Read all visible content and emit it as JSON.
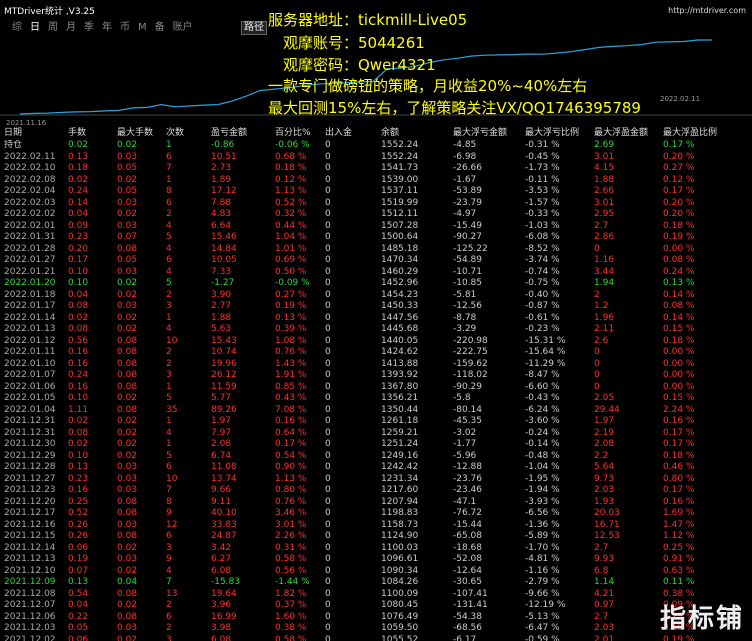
{
  "app": {
    "title": "MTDriver统计 ,V3.25",
    "site_url": "http://mtdriver.com"
  },
  "period_tabs": [
    "综",
    "日",
    "周",
    "月",
    "季",
    "年",
    "币",
    "M",
    "备",
    "账户"
  ],
  "active_tab": "日",
  "trace_button_label": "路径",
  "overlay": {
    "line1": "服务器地址：tickmill-Live05",
    "line2": "观摩账号：5044261",
    "line3": "观摩密码：Qwer4321",
    "line4": "一款专门做磅钮的策略，月收益20%~40%左右",
    "line5": "最大回测15%左右，了解策略关注VX/QQ1746395789"
  },
  "chart_data": {
    "type": "line",
    "x_start_label": "2021.11.16",
    "x_end_label": "2022.02.11",
    "color": "#29a3e0",
    "baseline_color": "#444444",
    "grid": false,
    "y_label_visible": false,
    "balance": [
      1034,
      1038,
      1040,
      1045,
      1049,
      1051,
      1055.52,
      1059.5,
      1076.49,
      1080.45,
      1100.09,
      1084.26,
      1090.34,
      1096.61,
      1100.03,
      1123.97,
      1158.73,
      1198.83,
      1207.94,
      1217.6,
      1231.34,
      1242.42,
      1249.16,
      1251.24,
      1259.21,
      1261.18,
      1350.44,
      1356.21,
      1367.8,
      1393.92,
      1413.88,
      1424.62,
      1440.05,
      1445.68,
      1447.56,
      1450.33,
      1454.23,
      1452.96,
      1460.29,
      1470.34,
      1485.18,
      1500.64,
      1507.28,
      1512.11,
      1519.99,
      1537.11,
      1539.0,
      1541.73,
      1552.24,
      1552.24
    ]
  },
  "watermark": "指标铺",
  "table": {
    "headers": [
      "日期",
      "手数",
      "最大手数",
      "次数",
      "盈亏金额",
      "百分比%",
      "出入金",
      "余额",
      "最大浮亏金额",
      "最大浮亏比例",
      "最大浮盈金额",
      "最大浮盈比例"
    ],
    "rows": [
      {
        "date": "持仓",
        "lots": "0.02",
        "max_lots": "0.02",
        "count": "1",
        "pl": "-0.86",
        "pct": "-0.06 %",
        "dep": "0",
        "bal": "1552.24",
        "mdd": "-4.85",
        "mdd_pct": "-0.31 %",
        "mfe": "2.69",
        "mfe_pct": "0.17 %",
        "pos": true
      },
      {
        "date": "2022.02.11",
        "lots": "0.13",
        "max_lots": "0.03",
        "count": "6",
        "pl": "10.51",
        "pct": "0.68 %",
        "dep": "0",
        "bal": "1552.24",
        "mdd": "-6.98",
        "mdd_pct": "-0.45 %",
        "mfe": "3.01",
        "mfe_pct": "0.20 %",
        "pos": false
      },
      {
        "date": "2022.02.10",
        "lots": "0.18",
        "max_lots": "0.05",
        "count": "7",
        "pl": "2.73",
        "pct": "0.18 %",
        "dep": "0",
        "bal": "1541.73",
        "mdd": "-26.66",
        "mdd_pct": "-1.73 %",
        "mfe": "4.15",
        "mfe_pct": "0.27 %",
        "pos": false
      },
      {
        "date": "2022.02.08",
        "lots": "0.02",
        "max_lots": "0.02",
        "count": "1",
        "pl": "1.89",
        "pct": "0.12 %",
        "dep": "0",
        "bal": "1539.00",
        "mdd": "-1.67",
        "mdd_pct": "-0.11 %",
        "mfe": "1.88",
        "mfe_pct": "0.12 %",
        "pos": false
      },
      {
        "date": "2022.02.04",
        "lots": "0.24",
        "max_lots": "0.05",
        "count": "8",
        "pl": "17.12",
        "pct": "1.13 %",
        "dep": "0",
        "bal": "1537.11",
        "mdd": "-53.89",
        "mdd_pct": "-3.53 %",
        "mfe": "2.66",
        "mfe_pct": "0.17 %",
        "pos": false
      },
      {
        "date": "2022.02.03",
        "lots": "0.14",
        "max_lots": "0.03",
        "count": "6",
        "pl": "7.88",
        "pct": "0.52 %",
        "dep": "0",
        "bal": "1519.99",
        "mdd": "-23.79",
        "mdd_pct": "-1.57 %",
        "mfe": "3.01",
        "mfe_pct": "0.20 %",
        "pos": false
      },
      {
        "date": "2022.02.02",
        "lots": "0.04",
        "max_lots": "0.02",
        "count": "2",
        "pl": "4.83",
        "pct": "0.32 %",
        "dep": "0",
        "bal": "1512.11",
        "mdd": "-4.97",
        "mdd_pct": "-0.33 %",
        "mfe": "2.95",
        "mfe_pct": "0.20 %",
        "pos": false
      },
      {
        "date": "2022.02.01",
        "lots": "0.09",
        "max_lots": "0.03",
        "count": "4",
        "pl": "6.64",
        "pct": "0.44 %",
        "dep": "0",
        "bal": "1507.28",
        "mdd": "-15.49",
        "mdd_pct": "-1.03 %",
        "mfe": "2.7",
        "mfe_pct": "0.18 %",
        "pos": false
      },
      {
        "date": "2022.01.31",
        "lots": "0.23",
        "max_lots": "0.07",
        "count": "5",
        "pl": "15.46",
        "pct": "1.04 %",
        "dep": "0",
        "bal": "1500.64",
        "mdd": "-90.27",
        "mdd_pct": "-6.08 %",
        "mfe": "2.86",
        "mfe_pct": "0.19 %",
        "pos": false
      },
      {
        "date": "2022.01.28",
        "lots": "0.20",
        "max_lots": "0.08",
        "count": "4",
        "pl": "14.84",
        "pct": "1.01 %",
        "dep": "0",
        "bal": "1485.18",
        "mdd": "-125.22",
        "mdd_pct": "-8.52 %",
        "mfe": "0",
        "mfe_pct": "0.00 %",
        "pos": false
      },
      {
        "date": "2022.01.27",
        "lots": "0.17",
        "max_lots": "0.05",
        "count": "6",
        "pl": "10.05",
        "pct": "0.69 %",
        "dep": "0",
        "bal": "1470.34",
        "mdd": "-54.89",
        "mdd_pct": "-3.74 %",
        "mfe": "1.16",
        "mfe_pct": "0.08 %",
        "pos": false
      },
      {
        "date": "2022.01.21",
        "lots": "0.10",
        "max_lots": "0.03",
        "count": "4",
        "pl": "7.33",
        "pct": "0.50 %",
        "dep": "0",
        "bal": "1460.29",
        "mdd": "-10.71",
        "mdd_pct": "-0.74 %",
        "mfe": "3.44",
        "mfe_pct": "0.24 %",
        "pos": false
      },
      {
        "date": "2022.01.20",
        "lots": "0.10",
        "max_lots": "0.02",
        "count": "5",
        "pl": "-1.27",
        "pct": "-0.09 %",
        "dep": "0",
        "bal": "1452.96",
        "mdd": "-10.85",
        "mdd_pct": "-0.75 %",
        "mfe": "1.94",
        "mfe_pct": "0.13 %",
        "pos": true
      },
      {
        "date": "2022.01.18",
        "lots": "0.04",
        "max_lots": "0.02",
        "count": "2",
        "pl": "3.90",
        "pct": "0.27 %",
        "dep": "0",
        "bal": "1454.23",
        "mdd": "-5.81",
        "mdd_pct": "-0.40 %",
        "mfe": "2",
        "mfe_pct": "0.14 %",
        "pos": false
      },
      {
        "date": "2022.01.17",
        "lots": "0.08",
        "max_lots": "0.03",
        "count": "3",
        "pl": "2.77",
        "pct": "0.19 %",
        "dep": "0",
        "bal": "1450.33",
        "mdd": "-12.56",
        "mdd_pct": "-0.87 %",
        "mfe": "1.2",
        "mfe_pct": "0.08 %",
        "pos": false
      },
      {
        "date": "2022.01.14",
        "lots": "0.02",
        "max_lots": "0.02",
        "count": "1",
        "pl": "1.88",
        "pct": "0.13 %",
        "dep": "0",
        "bal": "1447.56",
        "mdd": "-8.78",
        "mdd_pct": "-0.61 %",
        "mfe": "1.96",
        "mfe_pct": "0.14 %",
        "pos": false
      },
      {
        "date": "2022.01.13",
        "lots": "0.08",
        "max_lots": "0.02",
        "count": "4",
        "pl": "5.63",
        "pct": "0.39 %",
        "dep": "0",
        "bal": "1445.68",
        "mdd": "-3.29",
        "mdd_pct": "-0.23 %",
        "mfe": "2.11",
        "mfe_pct": "0.15 %",
        "pos": false
      },
      {
        "date": "2022.01.12",
        "lots": "0.56",
        "max_lots": "0.08",
        "count": "10",
        "pl": "15.43",
        "pct": "1.08 %",
        "dep": "0",
        "bal": "1440.05",
        "mdd": "-220.98",
        "mdd_pct": "-15.31 %",
        "mfe": "2.6",
        "mfe_pct": "0.18 %",
        "pos": false
      },
      {
        "date": "2022.01.11",
        "lots": "0.16",
        "max_lots": "0.08",
        "count": "2",
        "pl": "10.74",
        "pct": "0.76 %",
        "dep": "0",
        "bal": "1424.62",
        "mdd": "-222.75",
        "mdd_pct": "-15.64 %",
        "mfe": "0",
        "mfe_pct": "0.00 %",
        "pos": false
      },
      {
        "date": "2022.01.10",
        "lots": "0.16",
        "max_lots": "0.08",
        "count": "2",
        "pl": "19.96",
        "pct": "1.43 %",
        "dep": "0",
        "bal": "1413.88",
        "mdd": "-159.62",
        "mdd_pct": "-11.29 %",
        "mfe": "0",
        "mfe_pct": "0.00 %",
        "pos": false
      },
      {
        "date": "2022.01.07",
        "lots": "0.24",
        "max_lots": "0.08",
        "count": "3",
        "pl": "26.12",
        "pct": "1.91 %",
        "dep": "0",
        "bal": "1393.92",
        "mdd": "-118.02",
        "mdd_pct": "-8.47 %",
        "mfe": "0",
        "mfe_pct": "0.00 %",
        "pos": false
      },
      {
        "date": "2022.01.06",
        "lots": "0.16",
        "max_lots": "0.08",
        "count": "1",
        "pl": "11.59",
        "pct": "0.85 %",
        "dep": "0",
        "bal": "1367.80",
        "mdd": "-90.29",
        "mdd_pct": "-6.60 %",
        "mfe": "0",
        "mfe_pct": "0.00 %",
        "pos": false
      },
      {
        "date": "2022.01.05",
        "lots": "0.10",
        "max_lots": "0.02",
        "count": "5",
        "pl": "5.77",
        "pct": "0.43 %",
        "dep": "0",
        "bal": "1356.21",
        "mdd": "-5.8",
        "mdd_pct": "-0.43 %",
        "mfe": "2.05",
        "mfe_pct": "0.15 %",
        "pos": false
      },
      {
        "date": "2022.01.04",
        "lots": "1.11",
        "max_lots": "0.08",
        "count": "35",
        "pl": "89.26",
        "pct": "7.08 %",
        "dep": "0",
        "bal": "1350.44",
        "mdd": "-80.14",
        "mdd_pct": "-6.24 %",
        "mfe": "29.44",
        "mfe_pct": "2.24 %",
        "pos": false
      },
      {
        "date": "2021.12.31",
        "lots": "0.02",
        "max_lots": "0.02",
        "count": "1",
        "pl": "1.97",
        "pct": "0.16 %",
        "dep": "0",
        "bal": "1261.18",
        "mdd": "-45.35",
        "mdd_pct": "-3.60 %",
        "mfe": "1.97",
        "mfe_pct": "0.16 %",
        "pos": false
      },
      {
        "date": "2021.12.31",
        "lots": "0.08",
        "max_lots": "0.02",
        "count": "4",
        "pl": "7.97",
        "pct": "0.64 %",
        "dep": "0",
        "bal": "1259.21",
        "mdd": "-3.02",
        "mdd_pct": "-0.24 %",
        "mfe": "2.19",
        "mfe_pct": "0.17 %",
        "pos": false
      },
      {
        "date": "2021.12.30",
        "lots": "0.02",
        "max_lots": "0.02",
        "count": "1",
        "pl": "2.08",
        "pct": "0.17 %",
        "dep": "0",
        "bal": "1251.24",
        "mdd": "-1.77",
        "mdd_pct": "-0.14 %",
        "mfe": "2.08",
        "mfe_pct": "0.17 %",
        "pos": false
      },
      {
        "date": "2021.12.29",
        "lots": "0.10",
        "max_lots": "0.02",
        "count": "5",
        "pl": "6.74",
        "pct": "0.54 %",
        "dep": "0",
        "bal": "1249.16",
        "mdd": "-5.96",
        "mdd_pct": "-0.48 %",
        "mfe": "2.2",
        "mfe_pct": "0.18 %",
        "pos": false
      },
      {
        "date": "2021.12.28",
        "lots": "0.13",
        "max_lots": "0.03",
        "count": "6",
        "pl": "11.08",
        "pct": "0.90 %",
        "dep": "0",
        "bal": "1242.42",
        "mdd": "-12.88",
        "mdd_pct": "-1.04 %",
        "mfe": "5.64",
        "mfe_pct": "0.46 %",
        "pos": false
      },
      {
        "date": "2021.12.27",
        "lots": "0.23",
        "max_lots": "0.03",
        "count": "10",
        "pl": "13.74",
        "pct": "1.13 %",
        "dep": "0",
        "bal": "1231.34",
        "mdd": "-23.76",
        "mdd_pct": "-1.95 %",
        "mfe": "9.73",
        "mfe_pct": "0.80 %",
        "pos": false
      },
      {
        "date": "2021.12.23",
        "lots": "0.16",
        "max_lots": "0.03",
        "count": "7",
        "pl": "9.66",
        "pct": "0.80 %",
        "dep": "0",
        "bal": "1217.60",
        "mdd": "-23.46",
        "mdd_pct": "-1.94 %",
        "mfe": "2.03",
        "mfe_pct": "0.17 %",
        "pos": false
      },
      {
        "date": "2021.12.20",
        "lots": "0.25",
        "max_lots": "0.08",
        "count": "8",
        "pl": "9.11",
        "pct": "0.76 %",
        "dep": "0",
        "bal": "1207.94",
        "mdd": "-47.1",
        "mdd_pct": "-3.93 %",
        "mfe": "1.93",
        "mfe_pct": "0.16 %",
        "pos": false
      },
      {
        "date": "2021.12.17",
        "lots": "0.52",
        "max_lots": "0.08",
        "count": "9",
        "pl": "40.10",
        "pct": "3.46 %",
        "dep": "0",
        "bal": "1198.83",
        "mdd": "-76.72",
        "mdd_pct": "-6.56 %",
        "mfe": "20.03",
        "mfe_pct": "1.69 %",
        "pos": false
      },
      {
        "date": "2021.12.16",
        "lots": "0.26",
        "max_lots": "0.03",
        "count": "12",
        "pl": "33.83",
        "pct": "3.01 %",
        "dep": "0",
        "bal": "1158.73",
        "mdd": "-15.44",
        "mdd_pct": "-1.36 %",
        "mfe": "16.71",
        "mfe_pct": "1.47 %",
        "pos": false
      },
      {
        "date": "2021.12.15",
        "lots": "0.26",
        "max_lots": "0.08",
        "count": "6",
        "pl": "24.87",
        "pct": "2.26 %",
        "dep": "0",
        "bal": "1124.90",
        "mdd": "-65.08",
        "mdd_pct": "-5.89 %",
        "mfe": "12.53",
        "mfe_pct": "1.12 %",
        "pos": false
      },
      {
        "date": "2021.12.14",
        "lots": "0.06",
        "max_lots": "0.02",
        "count": "3",
        "pl": "3.42",
        "pct": "0.31 %",
        "dep": "0",
        "bal": "1100.03",
        "mdd": "-18.68",
        "mdd_pct": "-1.70 %",
        "mfe": "2.7",
        "mfe_pct": "0.25 %",
        "pos": false
      },
      {
        "date": "2021.12.13",
        "lots": "0.19",
        "max_lots": "0.03",
        "count": "9",
        "pl": "6.27",
        "pct": "0.58 %",
        "dep": "0",
        "bal": "1096.61",
        "mdd": "-52.08",
        "mdd_pct": "-4.81 %",
        "mfe": "9.93",
        "mfe_pct": "0.91 %",
        "pos": false
      },
      {
        "date": "2021.12.10",
        "lots": "0.07",
        "max_lots": "0.02",
        "count": "4",
        "pl": "6.08",
        "pct": "0.56 %",
        "dep": "0",
        "bal": "1090.34",
        "mdd": "-12.64",
        "mdd_pct": "-1.16 %",
        "mfe": "6.8",
        "mfe_pct": "0.63 %",
        "pos": false
      },
      {
        "date": "2021.12.09",
        "lots": "0.13",
        "max_lots": "0.04",
        "count": "7",
        "pl": "-15.83",
        "pct": "-1.44 %",
        "dep": "0",
        "bal": "1084.26",
        "mdd": "-30.65",
        "mdd_pct": "-2.79 %",
        "mfe": "1.14",
        "mfe_pct": "0.11 %",
        "pos": true
      },
      {
        "date": "2021.12.08",
        "lots": "0.54",
        "max_lots": "0.08",
        "count": "13",
        "pl": "19.64",
        "pct": "1.82 %",
        "dep": "0",
        "bal": "1100.09",
        "mdd": "-107.41",
        "mdd_pct": "-9.66 %",
        "mfe": "4.21",
        "mfe_pct": "0.38 %",
        "pos": false
      },
      {
        "date": "2021.12.07",
        "lots": "0.04",
        "max_lots": "0.02",
        "count": "2",
        "pl": "3.96",
        "pct": "0.37 %",
        "dep": "0",
        "bal": "1080.45",
        "mdd": "-131.41",
        "mdd_pct": "-12.19 %",
        "mfe": "0.97",
        "mfe_pct": "0.09 %",
        "pos": false
      },
      {
        "date": "2021.12.06",
        "lots": "0.22",
        "max_lots": "0.08",
        "count": "6",
        "pl": "16.99",
        "pct": "1.60 %",
        "dep": "0",
        "bal": "1076.49",
        "mdd": "-54.38",
        "mdd_pct": "-5.13 %",
        "mfe": "2.7",
        "mfe_pct": "0.25 %",
        "pos": false
      },
      {
        "date": "2021.12.03",
        "lots": "0.05",
        "max_lots": "0.03",
        "count": "2",
        "pl": "3.98",
        "pct": "0.38 %",
        "dep": "0",
        "bal": "1059.50",
        "mdd": "-68.56",
        "mdd_pct": "-6.47 %",
        "mfe": "2.03",
        "mfe_pct": "0.19 %",
        "pos": false
      },
      {
        "date": "2021.12.02",
        "lots": "0.06",
        "max_lots": "0.02",
        "count": "3",
        "pl": "6.08",
        "pct": "0.58 %",
        "dep": "0",
        "bal": "1055.52",
        "mdd": "-6.17",
        "mdd_pct": "-0.59 %",
        "mfe": "2.01",
        "mfe_pct": "0.19 %",
        "pos": false
      }
    ]
  }
}
